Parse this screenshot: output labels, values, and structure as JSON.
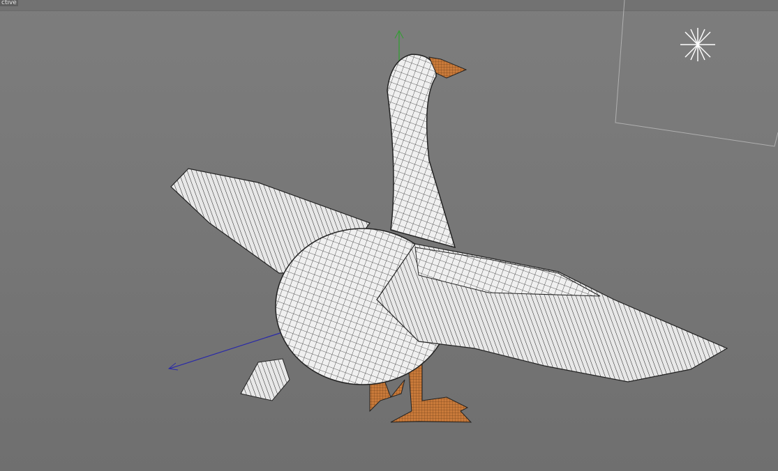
{
  "viewport": {
    "camera_label": "ctive",
    "colors": {
      "background": "#7b7b7b",
      "mesh": "#f2f2f2",
      "wire": "#222222",
      "beak": "#d08040",
      "y_axis": "#2fa02f",
      "z_axis": "#2a2aa8"
    }
  }
}
